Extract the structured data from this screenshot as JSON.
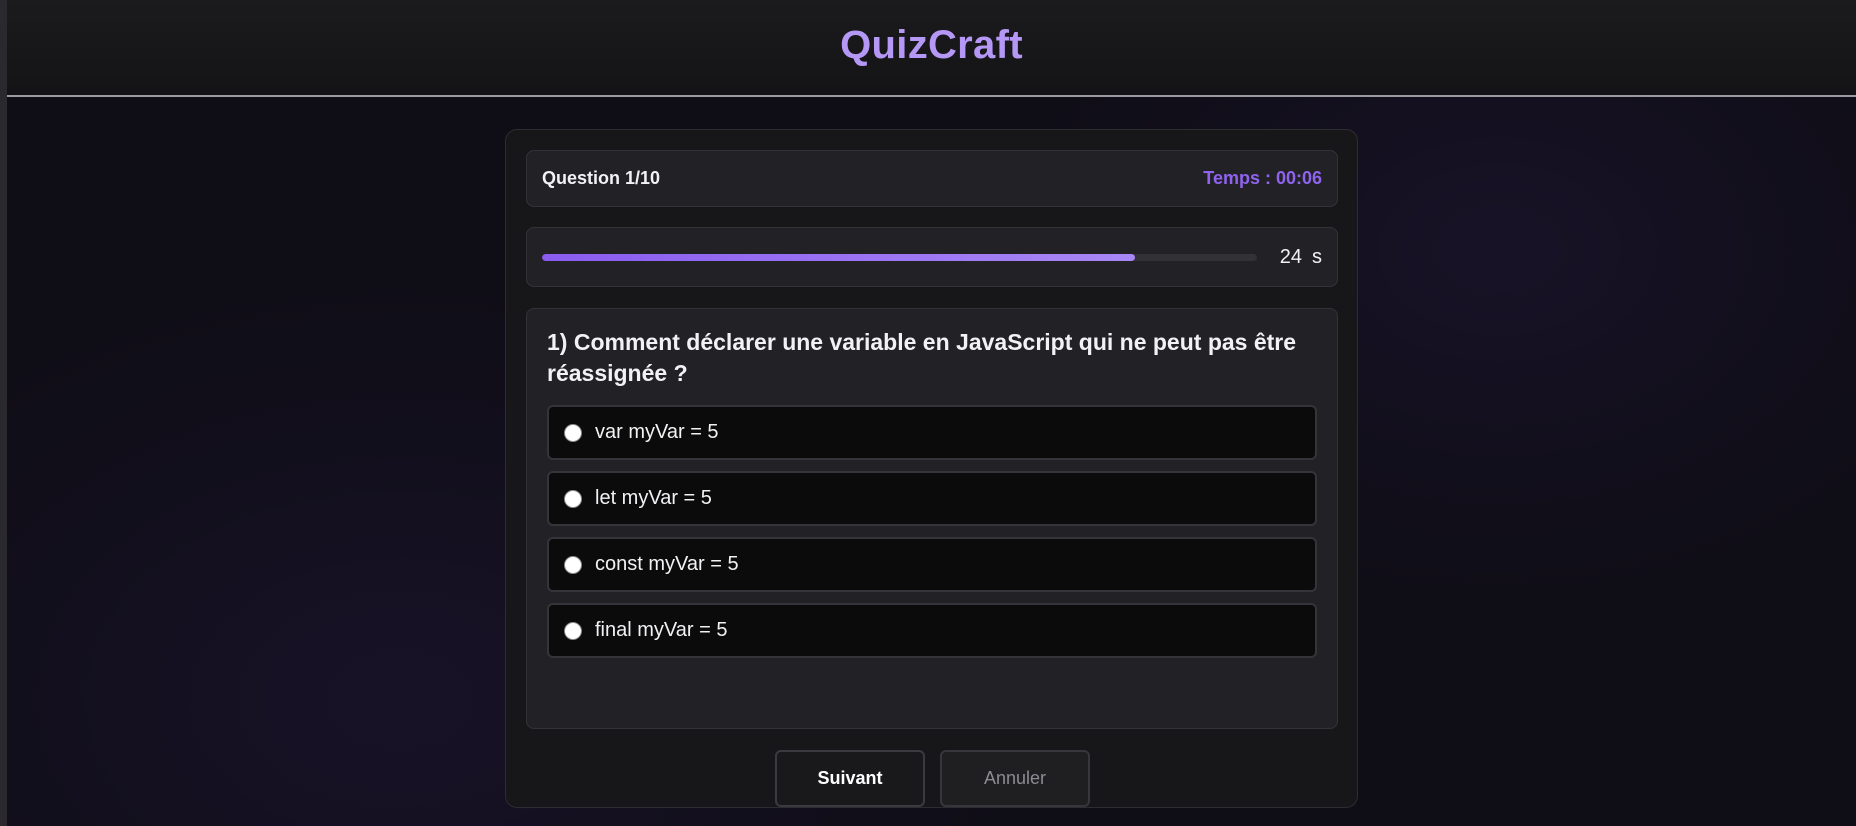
{
  "app": {
    "brand": "QuizCraft"
  },
  "quiz": {
    "question_counter": "Question 1/10",
    "timer_label": "Temps : 00:06",
    "countdown_value": "24",
    "countdown_unit": "s",
    "progress_fraction": 0.83,
    "question_text": "1) Comment déclarer une variable en JavaScript qui ne peut pas être réassignée ?",
    "options": [
      {
        "label": "var myVar = 5",
        "selected": false
      },
      {
        "label": "let myVar = 5",
        "selected": false
      },
      {
        "label": "const myVar = 5",
        "selected": false
      },
      {
        "label": "final myVar = 5",
        "selected": false
      }
    ]
  },
  "actions": {
    "next_label": "Suivant",
    "cancel_label": "Annuler"
  },
  "colors": {
    "accent": "#8f63ee",
    "brand": "#b597f5",
    "background": "#0f0d16"
  }
}
